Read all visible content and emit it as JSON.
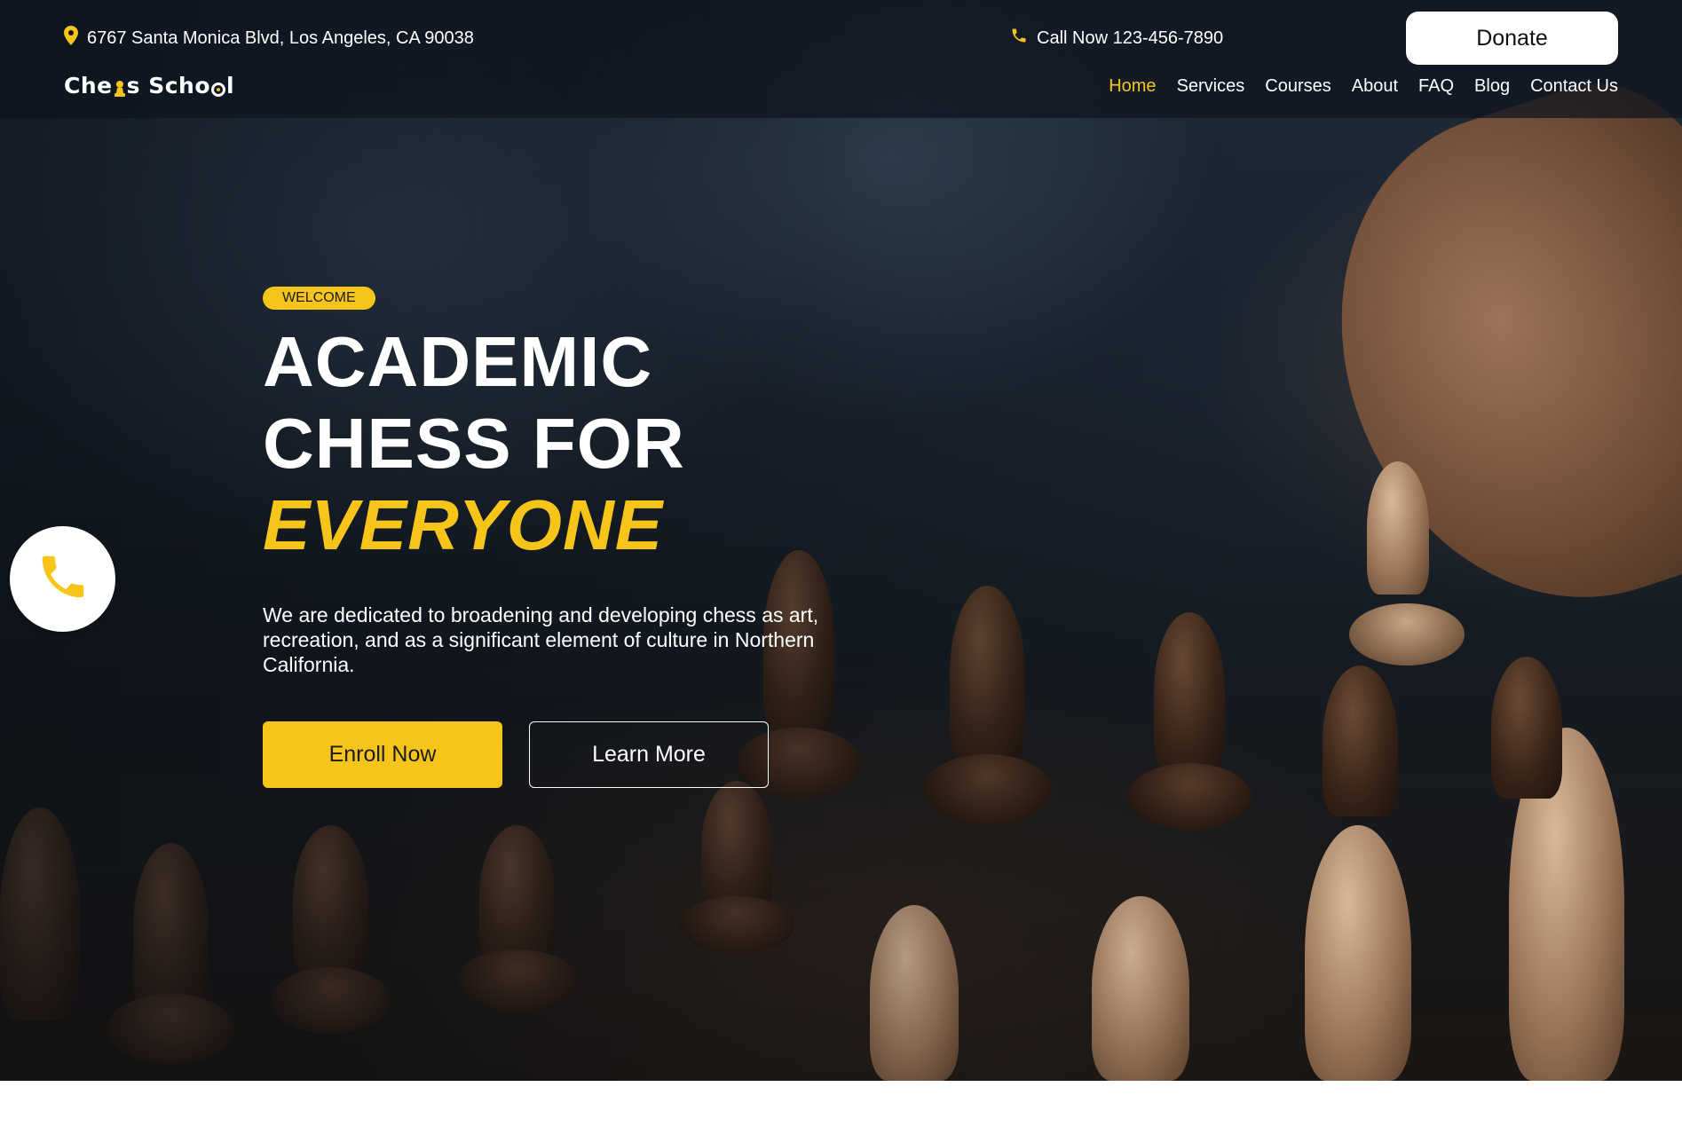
{
  "topbar": {
    "address": "6767 Santa Monica Blvd, Los Angeles, CA 90038",
    "address_icon": "map-pin-icon",
    "phone_text": "Call Now 123-456-7890",
    "phone_icon": "phone-icon",
    "donate_label": "Donate"
  },
  "brand": {
    "name_part1": "Che",
    "name_part2": "s Scho",
    "name_part3": "l"
  },
  "nav": {
    "items": [
      "Home",
      "Services",
      "Courses",
      "About",
      "FAQ",
      "Blog",
      "Contact Us"
    ],
    "active": "Home"
  },
  "hero": {
    "badge": "WELCOME",
    "headline_line1": "ACADEMIC",
    "headline_line2": "CHESS FOR",
    "headline_accent": "EVERYONE",
    "description": "We are dedicated to broadening and developing chess as art, recreation, and as a significant element of culture in Northern California.",
    "enroll_label": "Enroll Now",
    "learn_label": "Learn More"
  },
  "floating": {
    "icon": "phone-icon"
  },
  "colors": {
    "accent": "#f7c51a",
    "white": "#ffffff",
    "topbar_bg": "#0e141e"
  }
}
